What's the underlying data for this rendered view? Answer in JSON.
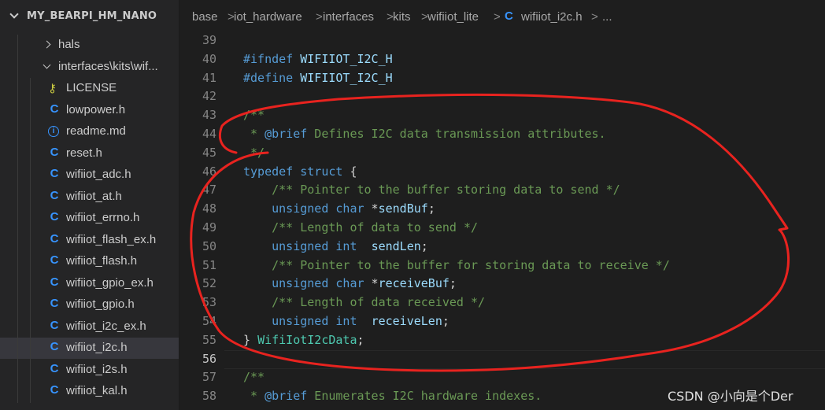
{
  "explorer": {
    "root_title": "MY_BEARPI_HM_NANO",
    "items": [
      {
        "label": "hals",
        "kind": "folder",
        "icon": "chevron-right-icon"
      },
      {
        "label": "interfaces\\kits\\wif...",
        "kind": "folder-open",
        "icon": "chevron-down-icon"
      },
      {
        "label": "LICENSE",
        "kind": "license",
        "icon": "license-key-icon"
      },
      {
        "label": "lowpower.h",
        "kind": "c",
        "icon": "c-file-icon"
      },
      {
        "label": "readme.md",
        "kind": "info",
        "icon": "info-file-icon"
      },
      {
        "label": "reset.h",
        "kind": "c",
        "icon": "c-file-icon"
      },
      {
        "label": "wifiiot_adc.h",
        "kind": "c",
        "icon": "c-file-icon"
      },
      {
        "label": "wifiiot_at.h",
        "kind": "c",
        "icon": "c-file-icon"
      },
      {
        "label": "wifiiot_errno.h",
        "kind": "c",
        "icon": "c-file-icon"
      },
      {
        "label": "wifiiot_flash_ex.h",
        "kind": "c",
        "icon": "c-file-icon"
      },
      {
        "label": "wifiiot_flash.h",
        "kind": "c",
        "icon": "c-file-icon"
      },
      {
        "label": "wifiiot_gpio_ex.h",
        "kind": "c",
        "icon": "c-file-icon"
      },
      {
        "label": "wifiiot_gpio.h",
        "kind": "c",
        "icon": "c-file-icon"
      },
      {
        "label": "wifiiot_i2c_ex.h",
        "kind": "c",
        "icon": "c-file-icon"
      },
      {
        "label": "wifiiot_i2c.h",
        "kind": "c",
        "icon": "c-file-icon",
        "active": true
      },
      {
        "label": "wifiiot_i2s.h",
        "kind": "c",
        "icon": "c-file-icon"
      },
      {
        "label": "wifiiot_kal.h",
        "kind": "c",
        "icon": "c-file-icon"
      }
    ],
    "c_glyph": "C",
    "info_glyph": "i",
    "key_glyph": "⚷"
  },
  "breadcrumb": {
    "parts": [
      "base",
      "iot_hardware",
      "interfaces",
      "kits",
      "wifiiot_lite"
    ],
    "file_icon": "C",
    "file": "wifiiot_i2c.h",
    "separator": ">",
    "more": "..."
  },
  "editor": {
    "current_line": "56",
    "lines": [
      {
        "n": "39",
        "tokens": []
      },
      {
        "n": "40",
        "tokens": [
          {
            "t": "#ifndef",
            "c": "pp"
          },
          {
            "t": " WIFIIOT_I2C_H",
            "c": "var"
          }
        ]
      },
      {
        "n": "41",
        "tokens": [
          {
            "t": "#define",
            "c": "pp"
          },
          {
            "t": " WIFIIOT_I2C_H",
            "c": "var"
          }
        ]
      },
      {
        "n": "42",
        "tokens": []
      },
      {
        "n": "43",
        "tokens": [
          {
            "t": "/**",
            "c": "com"
          }
        ]
      },
      {
        "n": "44",
        "tokens": [
          {
            "t": " * ",
            "c": "com"
          },
          {
            "t": "@brief",
            "c": "doc"
          },
          {
            "t": " Defines I2C data transmission attributes.",
            "c": "com"
          }
        ]
      },
      {
        "n": "45",
        "tokens": [
          {
            "t": " */",
            "c": "com"
          }
        ]
      },
      {
        "n": "46",
        "tokens": [
          {
            "t": "typedef",
            "c": "kw"
          },
          {
            "t": " ",
            "c": "txt"
          },
          {
            "t": "struct",
            "c": "kw"
          },
          {
            "t": " {",
            "c": "txt"
          }
        ]
      },
      {
        "n": "47",
        "tokens": [
          {
            "t": "    /** Pointer to the buffer storing data to send */",
            "c": "com"
          }
        ]
      },
      {
        "n": "48",
        "tokens": [
          {
            "t": "    unsigned",
            "c": "kw"
          },
          {
            "t": " ",
            "c": "txt"
          },
          {
            "t": "char",
            "c": "kw"
          },
          {
            "t": " *",
            "c": "txt"
          },
          {
            "t": "sendBuf",
            "c": "var"
          },
          {
            "t": ";",
            "c": "txt"
          }
        ]
      },
      {
        "n": "49",
        "tokens": [
          {
            "t": "    /** Length of data to send */",
            "c": "com"
          }
        ]
      },
      {
        "n": "50",
        "tokens": [
          {
            "t": "    unsigned",
            "c": "kw"
          },
          {
            "t": " ",
            "c": "txt"
          },
          {
            "t": "int",
            "c": "kw"
          },
          {
            "t": "  ",
            "c": "txt"
          },
          {
            "t": "sendLen",
            "c": "var"
          },
          {
            "t": ";",
            "c": "txt"
          }
        ]
      },
      {
        "n": "51",
        "tokens": [
          {
            "t": "    /** Pointer to the buffer for storing data to receive */",
            "c": "com"
          }
        ]
      },
      {
        "n": "52",
        "tokens": [
          {
            "t": "    unsigned",
            "c": "kw"
          },
          {
            "t": " ",
            "c": "txt"
          },
          {
            "t": "char",
            "c": "kw"
          },
          {
            "t": " *",
            "c": "txt"
          },
          {
            "t": "receiveBuf",
            "c": "var"
          },
          {
            "t": ";",
            "c": "txt"
          }
        ]
      },
      {
        "n": "53",
        "tokens": [
          {
            "t": "    /** Length of data received */",
            "c": "com"
          }
        ]
      },
      {
        "n": "54",
        "tokens": [
          {
            "t": "    unsigned",
            "c": "kw"
          },
          {
            "t": " ",
            "c": "txt"
          },
          {
            "t": "int",
            "c": "kw"
          },
          {
            "t": "  ",
            "c": "txt"
          },
          {
            "t": "receiveLen",
            "c": "var"
          },
          {
            "t": ";",
            "c": "txt"
          }
        ]
      },
      {
        "n": "55",
        "tokens": [
          {
            "t": "} ",
            "c": "txt"
          },
          {
            "t": "WifiIotI2cData",
            "c": "ty"
          },
          {
            "t": ";",
            "c": "txt"
          }
        ]
      },
      {
        "n": "56",
        "tokens": []
      },
      {
        "n": "57",
        "tokens": [
          {
            "t": "/**",
            "c": "com"
          }
        ]
      },
      {
        "n": "58",
        "tokens": [
          {
            "t": " * ",
            "c": "com"
          },
          {
            "t": "@brief",
            "c": "doc"
          },
          {
            "t": " Enumerates I2C hardware indexes.",
            "c": "com"
          }
        ]
      }
    ]
  },
  "colors": {
    "annotation": "#e8231f"
  },
  "watermark": "CSDN @小向是个Der"
}
